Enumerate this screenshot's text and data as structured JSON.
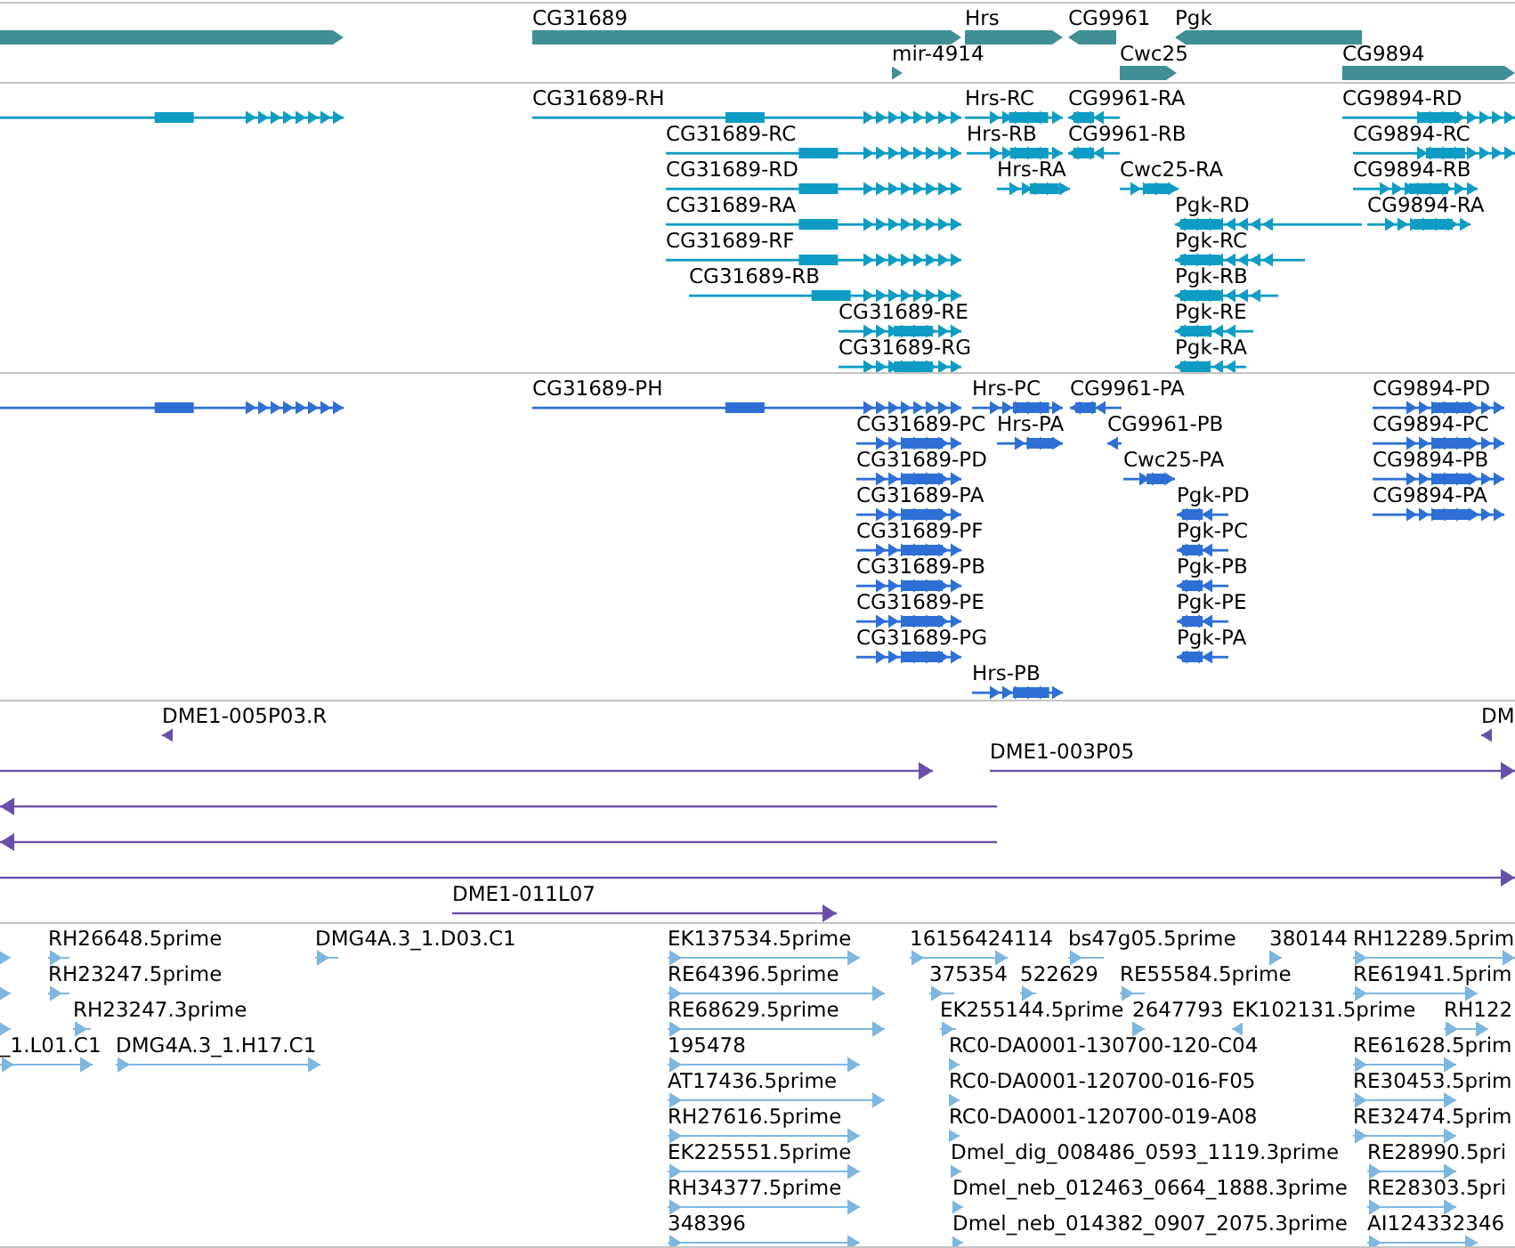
{
  "tracks": [
    {
      "kind": "gene",
      "color": "#3f8f95",
      "features": [
        {
          "label": "CG31689"
        },
        {
          "label": "Hrs"
        },
        {
          "label": "CG9961"
        },
        {
          "label": "Pgk"
        },
        {
          "label": "mir-4914"
        },
        {
          "label": "Cwc25"
        },
        {
          "label": "CG9894"
        }
      ]
    },
    {
      "kind": "transcript",
      "color": "#0e9cc4",
      "features": [
        {
          "label": "CG31689-RH"
        },
        {
          "label": "Hrs-RC"
        },
        {
          "label": "CG9961-RA"
        },
        {
          "label": "CG9894-RD"
        },
        {
          "label": "CG31689-RC"
        },
        {
          "label": "Hrs-RB"
        },
        {
          "label": "CG9961-RB"
        },
        {
          "label": "CG9894-RC"
        },
        {
          "label": "CG31689-RD"
        },
        {
          "label": "Hrs-RA"
        },
        {
          "label": "Cwc25-RA"
        },
        {
          "label": "CG9894-RB"
        },
        {
          "label": "CG31689-RA"
        },
        {
          "label": "Pgk-RD"
        },
        {
          "label": "CG9894-RA"
        },
        {
          "label": "CG31689-RF"
        },
        {
          "label": "Pgk-RC"
        },
        {
          "label": "CG31689-RB"
        },
        {
          "label": "Pgk-RB"
        },
        {
          "label": "CG31689-RE"
        },
        {
          "label": "Pgk-RE"
        },
        {
          "label": "CG31689-RG"
        },
        {
          "label": "Pgk-RA"
        }
      ]
    },
    {
      "kind": "protein",
      "color": "#2e6fd6",
      "features": [
        {
          "label": "CG31689-PH"
        },
        {
          "label": "Hrs-PC"
        },
        {
          "label": "CG9961-PA"
        },
        {
          "label": "CG9894-PD"
        },
        {
          "label": "CG31689-PC"
        },
        {
          "label": "Hrs-PA"
        },
        {
          "label": "CG9961-PB"
        },
        {
          "label": "CG9894-PC"
        },
        {
          "label": "CG31689-PD"
        },
        {
          "label": "Cwc25-PA"
        },
        {
          "label": "CG9894-PB"
        },
        {
          "label": "CG31689-PA"
        },
        {
          "label": "Pgk-PD"
        },
        {
          "label": "CG9894-PA"
        },
        {
          "label": "CG31689-PF"
        },
        {
          "label": "Pgk-PC"
        },
        {
          "label": "CG31689-PB"
        },
        {
          "label": "Pgk-PB"
        },
        {
          "label": "CG31689-PE"
        },
        {
          "label": "Pgk-PE"
        },
        {
          "label": "CG31689-PG"
        },
        {
          "label": "Pgk-PA"
        },
        {
          "label": "Hrs-PB"
        }
      ]
    },
    {
      "kind": "match",
      "color": "#6a4fa8",
      "features": [
        {
          "label": "DME1-005P03.R"
        },
        {
          "label": "DM"
        },
        {
          "label": "DME1-003P05"
        },
        {
          "label": "DME1-011L07"
        }
      ]
    },
    {
      "kind": "est",
      "color": "#7db6e0",
      "features": [
        {
          "label": "RH26648.5prime"
        },
        {
          "label": "DMG4A.3_1.D03.C1"
        },
        {
          "label": "EK137534.5prime"
        },
        {
          "label": "16156424114"
        },
        {
          "label": "bs47g05.5prime"
        },
        {
          "label": "380144"
        },
        {
          "label": "RH12289.5prim"
        },
        {
          "label": "RH23247.5prime"
        },
        {
          "label": "RE64396.5prime"
        },
        {
          "label": "375354"
        },
        {
          "label": "522629"
        },
        {
          "label": "RE55584.5prime"
        },
        {
          "label": "RE61941.5prim"
        },
        {
          "label": "RH23247.3prime"
        },
        {
          "label": "RE68629.5prime"
        },
        {
          "label": "EK255144.5prime"
        },
        {
          "label": "2647793"
        },
        {
          "label": "EK102131.5prime"
        },
        {
          "label": "RH122"
        },
        {
          "label": "_1.L01.C1"
        },
        {
          "label": "DMG4A.3_1.H17.C1"
        },
        {
          "label": "195478"
        },
        {
          "label": "RC0-DA0001-130700-120-C04"
        },
        {
          "label": "RE61628.5prim"
        },
        {
          "label": "AT17436.5prime"
        },
        {
          "label": "RC0-DA0001-120700-016-F05"
        },
        {
          "label": "RE30453.5prim"
        },
        {
          "label": "RH27616.5prime"
        },
        {
          "label": "RC0-DA0001-120700-019-A08"
        },
        {
          "label": "RE32474.5prim"
        },
        {
          "label": "EK225551.5prime"
        },
        {
          "label": "Dmel_dig_008486_0593_1119.3prime"
        },
        {
          "label": "RE28990.5pri"
        },
        {
          "label": "RH34377.5prime"
        },
        {
          "label": "Dmel_neb_012463_0664_1888.3prime"
        },
        {
          "label": "RE28303.5pri"
        },
        {
          "label": "348396"
        },
        {
          "label": "Dmel_neb_014382_0907_2075.3prime"
        },
        {
          "label": "AI124332346"
        }
      ]
    }
  ]
}
